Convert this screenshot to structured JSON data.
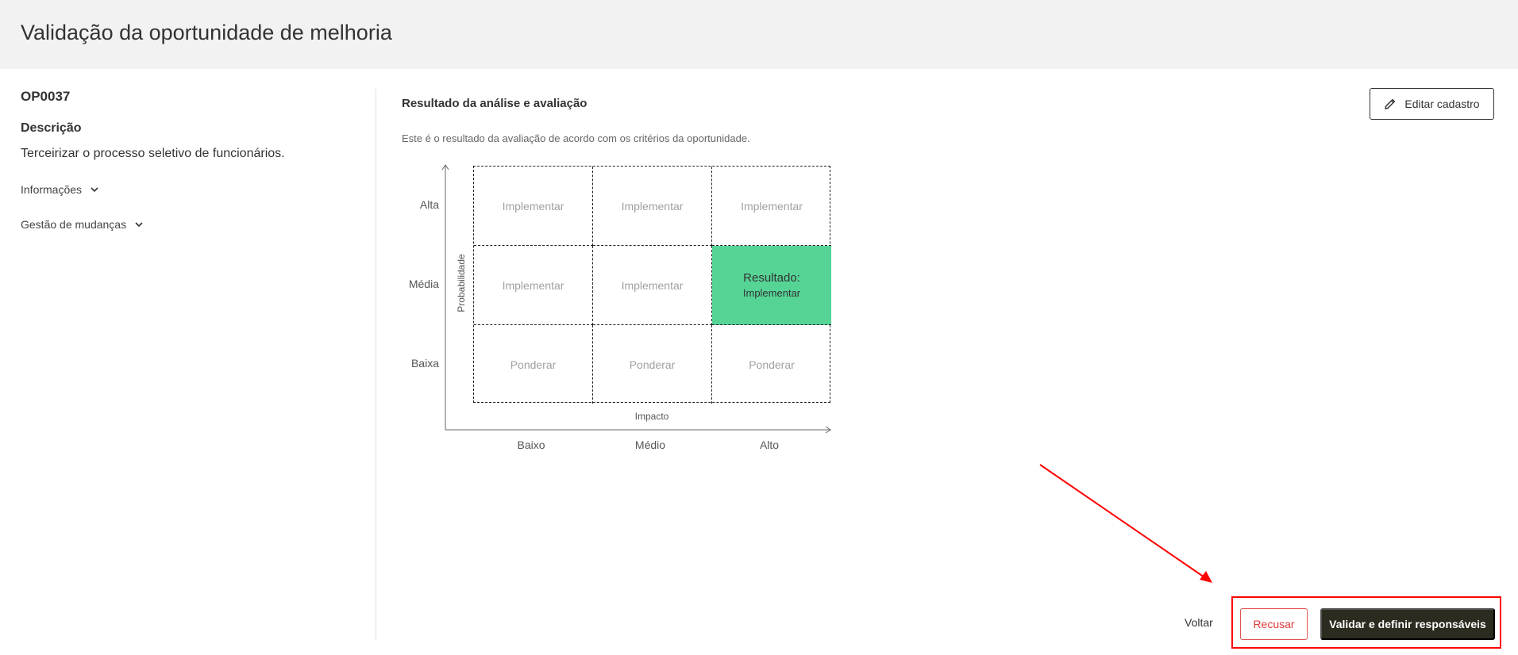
{
  "header": {
    "title": "Validação da oportunidade de melhoria"
  },
  "left": {
    "code": "OP0037",
    "description_label": "Descrição",
    "description_text": "Terceirizar o processo seletivo de funcionários.",
    "sections": [
      {
        "label": "Informações",
        "icon": "chevron-down-icon"
      },
      {
        "label": "Gestão de mudanças",
        "icon": "chevron-down-icon"
      }
    ]
  },
  "main": {
    "title": "Resultado da análise e avaliação",
    "description": "Este é o resultado da avaliação de acordo com os critérios da oportunidade.",
    "edit_button": {
      "label": "Editar cadastro",
      "icon": "pencil-icon"
    },
    "matrix": {
      "y_axis_title": "Probabilidade",
      "x_axis_title": "Impacto",
      "rows": [
        "Alta",
        "Média",
        "Baixa"
      ],
      "columns": [
        "Baixo",
        "Médio",
        "Alto"
      ],
      "cells": [
        [
          "Implementar",
          "Implementar",
          "Implementar"
        ],
        [
          "Implementar",
          "Implementar",
          "Implementar"
        ],
        [
          "Ponderar",
          "Ponderar",
          "Ponderar"
        ]
      ],
      "result_label": "Resultado:",
      "result_value": "Implementar",
      "result_color": "#55d496"
    }
  },
  "footer": {
    "back_label": "Voltar",
    "refuse_label": "Recusar",
    "validate_label": "Validar e definir responsáveis"
  },
  "colors": {
    "header_bg": "#f2f2f2",
    "primary_button": "#2b2b1f",
    "danger": "#e03a3a",
    "annotation": "#ff0000"
  }
}
